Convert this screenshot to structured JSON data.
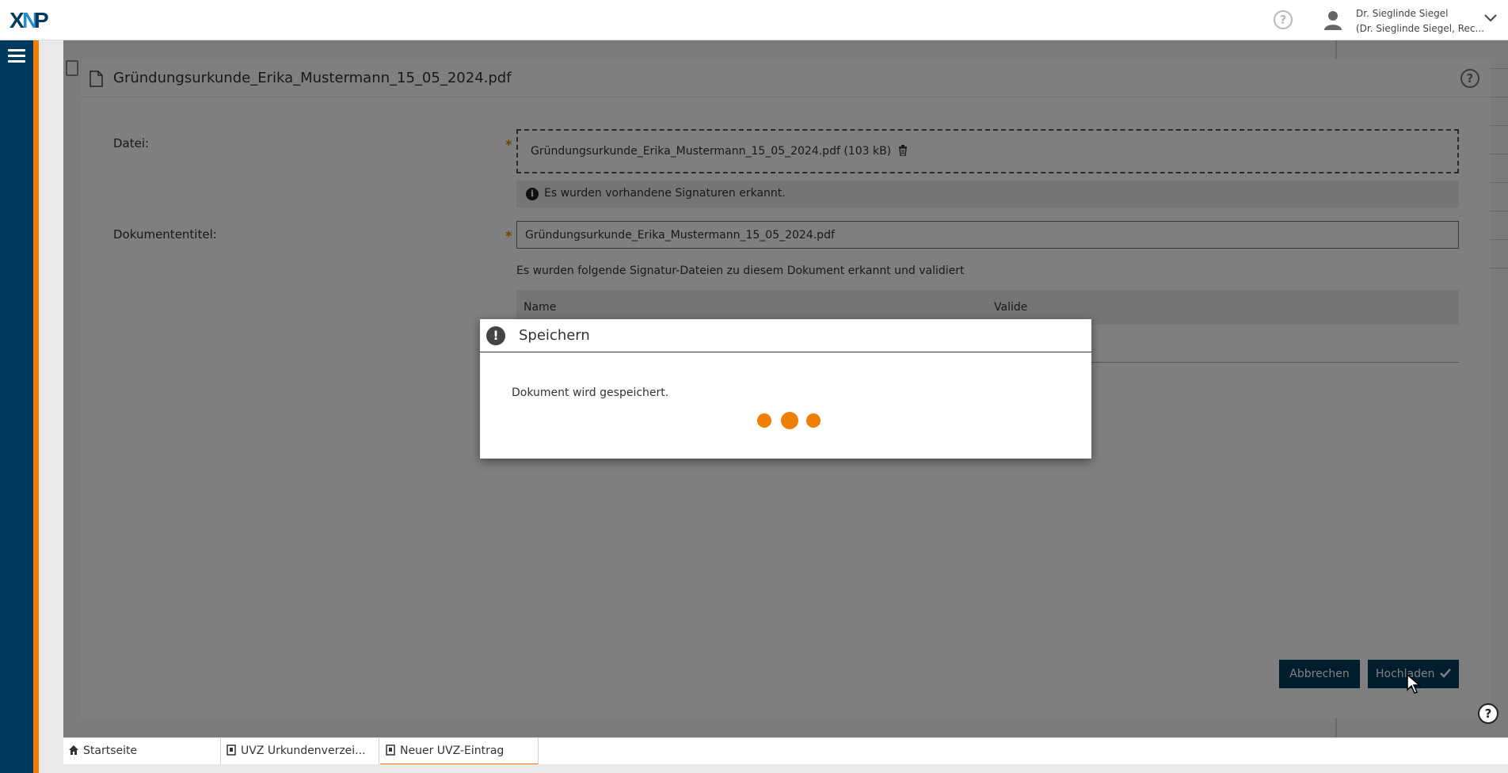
{
  "topbar": {
    "logo_text": "XNP",
    "user_name": "Dr. Sieglinde Siegel",
    "user_role": "(Dr. Sieglinde Siegel, Rec..."
  },
  "document_dialog": {
    "title": "Gründungsurkunde_Erika_Mustermann_15_05_2024.pdf",
    "file_label": "Datei:",
    "file_value": "Gründungsurkunde_Erika_Mustermann_15_05_2024.pdf (103 kB)",
    "info_message": "Es wurden vorhandene Signaturen erkannt.",
    "title_label": "Dokumententitel:",
    "title_value": "Gründungsurkunde_Erika_Mustermann_15_05_2024.pdf",
    "signature_text": "Es wurden folgende Signatur-Dateien zu diesem Dokument erkannt und validiert",
    "table_columns": [
      "Name",
      "Valide"
    ],
    "cancel_label": "Abbrechen",
    "upload_label": "Hochladen",
    "required_marker": "*"
  },
  "save_modal": {
    "title": "Speichern",
    "message": "Dokument wird gespeichert."
  },
  "bottom_tabs": [
    {
      "label": "Startseite",
      "icon": "home-icon"
    },
    {
      "label": "UVZ Urkundenverzei...",
      "icon": "document-icon"
    },
    {
      "label": "Neuer UVZ-Eintrag",
      "icon": "document-icon",
      "active": true
    }
  ],
  "colors": {
    "primary": "#003a5d",
    "accent": "#ee7f00"
  }
}
